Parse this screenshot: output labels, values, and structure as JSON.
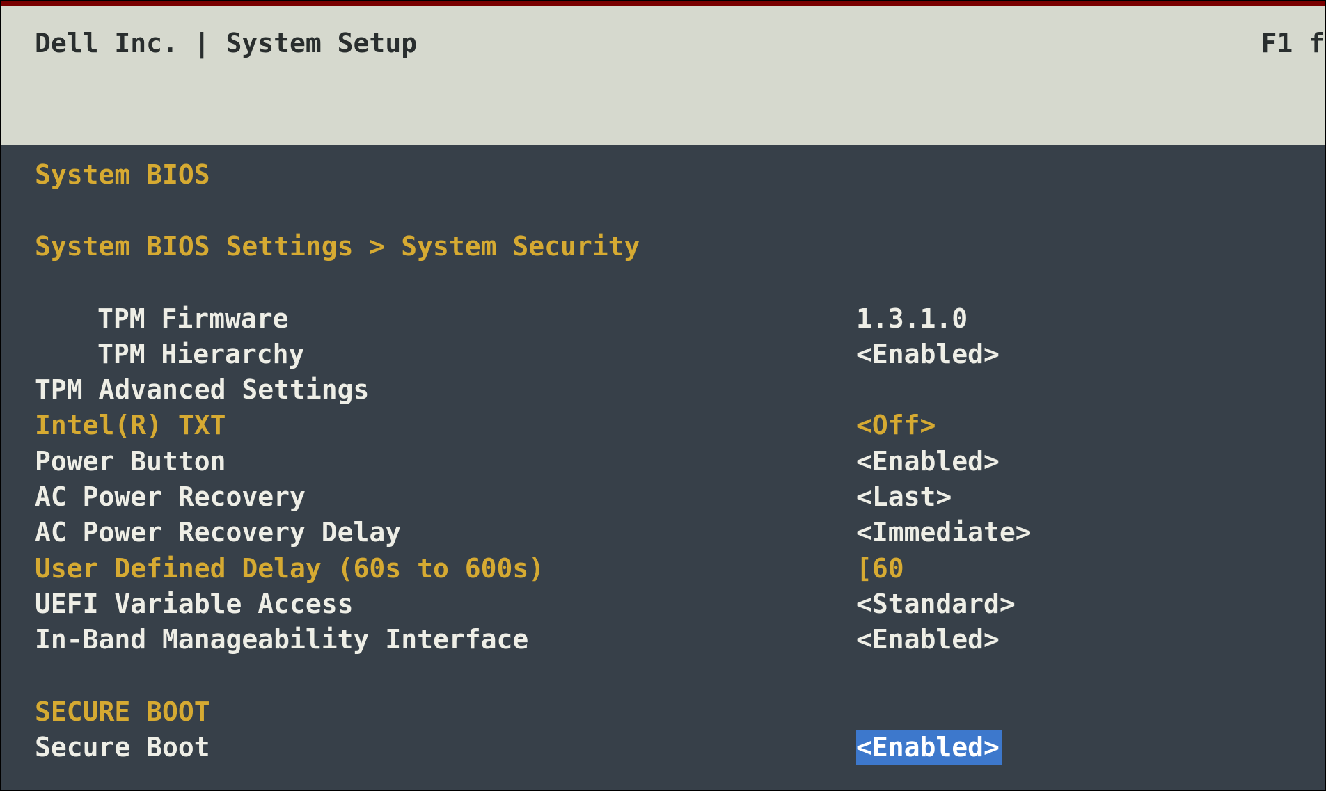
{
  "header": {
    "title": "Dell Inc. | System Setup",
    "help_hint": "F1 f"
  },
  "section_title": "System BIOS",
  "breadcrumb": "System BIOS Settings > System Security",
  "rows": {
    "tpm_firmware": {
      "label": "TPM Firmware",
      "value": "1.3.1.0"
    },
    "tpm_hierarchy": {
      "label": "TPM Hierarchy",
      "value": "<Enabled>"
    },
    "tpm_advanced": {
      "label": "TPM Advanced Settings",
      "value": ""
    },
    "intel_txt": {
      "label": "Intel(R) TXT",
      "value": "<Off>"
    },
    "power_button": {
      "label": "Power Button",
      "value": "<Enabled>"
    },
    "ac_power_recovery": {
      "label": "AC Power Recovery",
      "value": "<Last>"
    },
    "ac_power_recovery_delay": {
      "label": "AC Power Recovery Delay",
      "value": "<Immediate>"
    },
    "user_defined_delay": {
      "label": "User Defined Delay (60s to 600s)",
      "value": "[60"
    },
    "uefi_variable_access": {
      "label": "UEFI Variable Access",
      "value": "<Standard>"
    },
    "in_band_manageability": {
      "label": "In-Band Manageability Interface",
      "value": "<Enabled>"
    }
  },
  "secure_boot_header": "SECURE BOOT",
  "secure_boot": {
    "label": "Secure Boot",
    "value": "<Enabled>"
  }
}
